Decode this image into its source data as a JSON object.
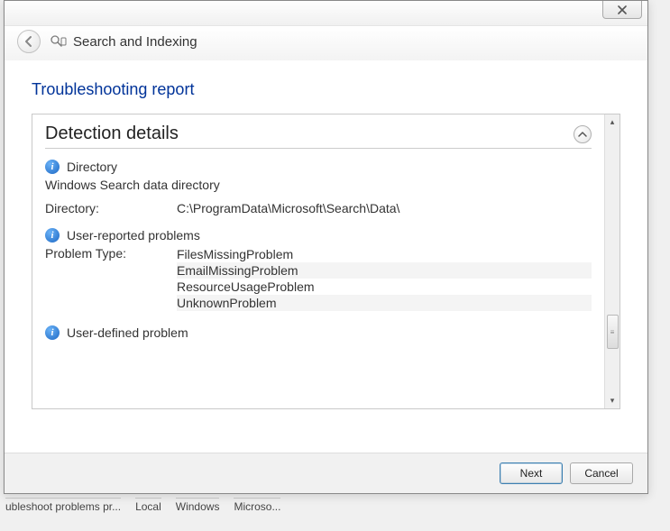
{
  "window": {
    "title": "Search and Indexing",
    "reportTitle": "Troubleshooting report"
  },
  "section": {
    "header": "Detection details"
  },
  "directory": {
    "heading": "Directory",
    "description": "Windows Search data directory",
    "label": "Directory:",
    "path": "C:\\ProgramData\\Microsoft\\Search\\Data\\"
  },
  "userReported": {
    "heading": "User-reported problems",
    "label": "Problem Type:",
    "types": [
      "FilesMissingProblem",
      "EmailMissingProblem",
      "ResourceUsageProblem",
      "UnknownProblem"
    ]
  },
  "userDefined": {
    "heading": "User-defined problem"
  },
  "buttons": {
    "next": "Next",
    "cancel": "Cancel"
  },
  "background": {
    "items": [
      "ubleshoot problems pr...",
      "Local",
      "Windows",
      "Microso..."
    ]
  }
}
